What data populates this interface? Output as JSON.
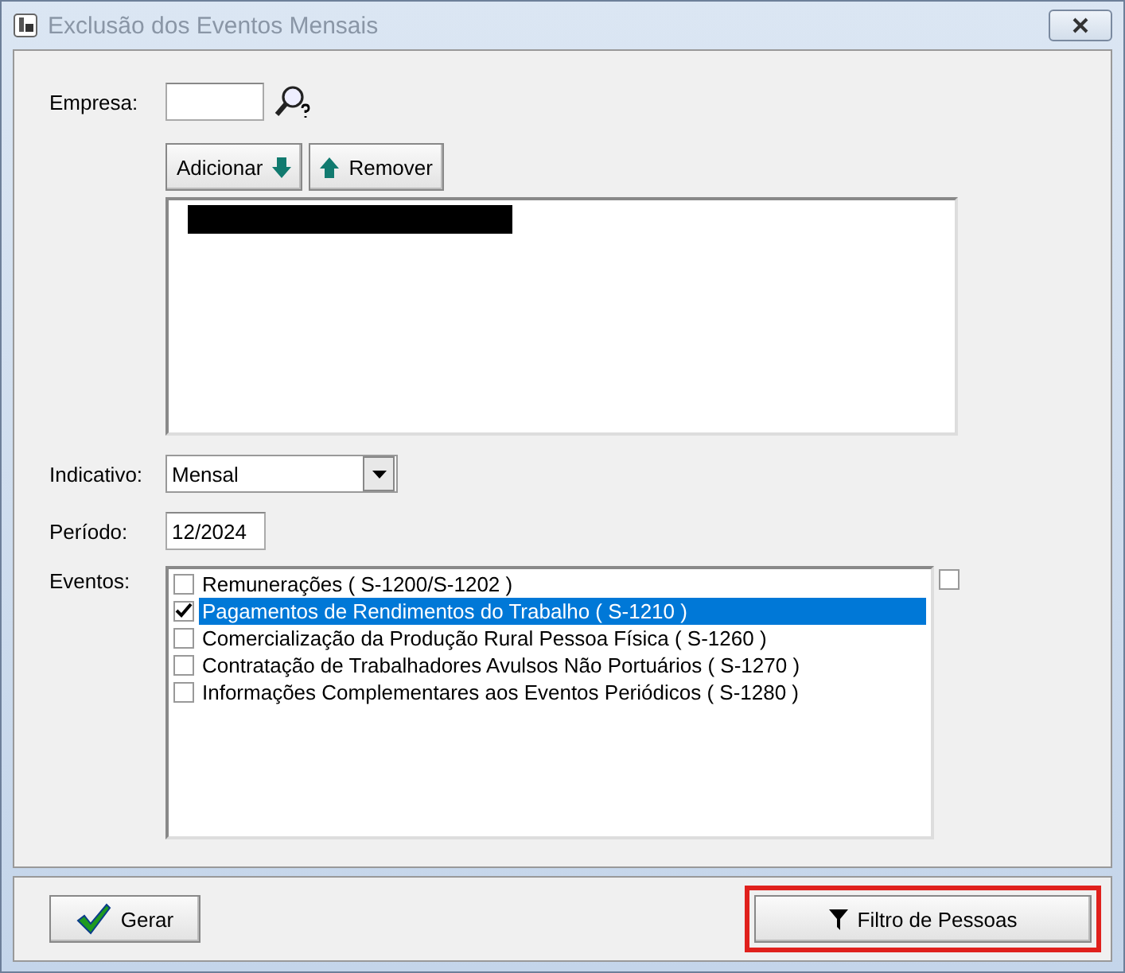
{
  "window": {
    "title": "Exclusão dos Eventos Mensais"
  },
  "empresa": {
    "label": "Empresa:"
  },
  "buttons": {
    "add": "Adicionar",
    "remove": "Remover"
  },
  "companies": [
    {
      "kind": "redacted"
    }
  ],
  "indicativo": {
    "label": "Indicativo:",
    "value": "Mensal"
  },
  "periodo": {
    "label": "Período:",
    "value": "12/2024"
  },
  "eventos": {
    "label": "Eventos:",
    "select_all": {
      "checked": false
    },
    "items": [
      {
        "label": "Remunerações ( S-1200/S-1202 )",
        "checked": false,
        "selected": false
      },
      {
        "label": "Pagamentos de Rendimentos do Trabalho ( S-1210 )",
        "checked": true,
        "selected": true
      },
      {
        "label": "Comercialização da Produção Rural Pessoa Física ( S-1260 )",
        "checked": false,
        "selected": false
      },
      {
        "label": "Contratação de Trabalhadores Avulsos Não Portuários ( S-1270 )",
        "checked": false,
        "selected": false
      },
      {
        "label": "Informações Complementares aos Eventos Periódicos ( S-1280 )",
        "checked": false,
        "selected": false
      }
    ]
  },
  "footer": {
    "generate": "Gerar",
    "filter": "Filtro de Pessoas",
    "filter_highlighted": true
  }
}
